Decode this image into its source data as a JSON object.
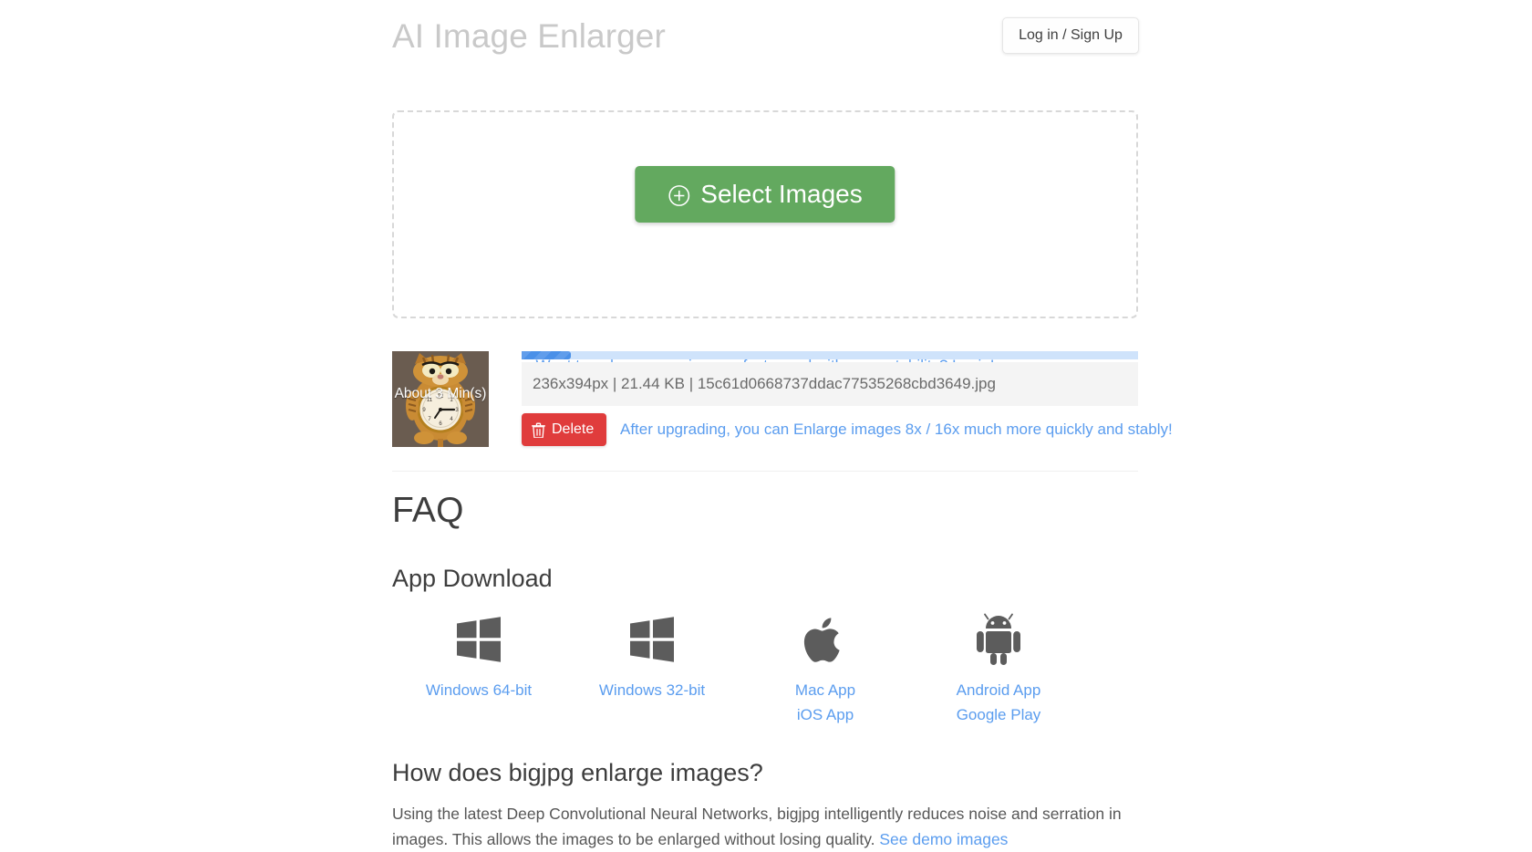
{
  "header": {
    "app_title": "AI Image Enlarger",
    "login_button": "Log in / Sign Up"
  },
  "dropzone": {
    "select_button": "Select Images",
    "select_icon": "plus-circle-icon",
    "promo_link": "Want to enlarge more images faster and with more stability? Login!"
  },
  "file_row": {
    "thumbnail_overlay": "About 3 Min(s)",
    "progress_percent": 8,
    "file_info": "236x394px | 21.44 KB | 15c61d0668737ddac77535268cbd3649.jpg",
    "dimensions": "236x394px",
    "file_size": "21.44 KB",
    "file_name": "15c61d0668737ddac77535268cbd3649.jpg",
    "delete_button": "Delete",
    "delete_icon": "trash-icon",
    "upgrade_note": "After upgrading, you can Enlarge images 8x / 16x much more quickly and stably!"
  },
  "faq": {
    "title": "FAQ",
    "app_download": {
      "heading": "App Download",
      "platforms": [
        {
          "icon": "windows-icon",
          "links": [
            "Windows 64-bit"
          ]
        },
        {
          "icon": "windows-icon",
          "links": [
            "Windows 32-bit"
          ]
        },
        {
          "icon": "apple-icon",
          "links": [
            "Mac App",
            "iOS App"
          ]
        },
        {
          "icon": "android-icon",
          "links": [
            "Android App",
            "Google Play"
          ]
        }
      ]
    },
    "question": {
      "title": "How does bigjpg enlarge images?",
      "body": "Using the latest Deep Convolutional Neural Networks, bigjpg intelligently reduces noise and serration in images. This allows the images to be enlarged without losing quality. ",
      "link": "See demo images"
    }
  },
  "colors": {
    "accent_green": "#63a95f",
    "link_blue": "#5b9def",
    "danger_red": "#e03c3c",
    "progress_blue": "#4a90e8",
    "progress_track": "#cfe3fb",
    "title_gray": "#c9c9c9"
  }
}
